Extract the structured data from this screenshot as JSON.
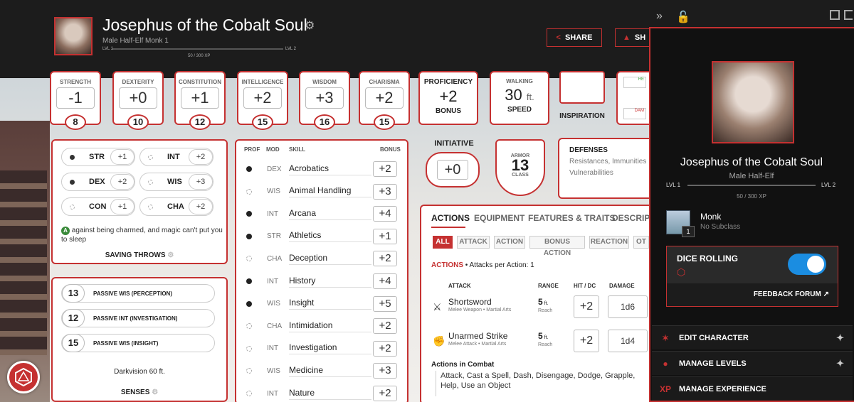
{
  "header": {
    "name": "Josephus of the Cobalt Soul",
    "subtitle": "Male  Half-Elf  Monk 1",
    "lvl_left": "LVL 1",
    "lvl_right": "LVL 2",
    "xp": "50 / 300 XP",
    "share_label": "SHARE",
    "share2_label": "SH"
  },
  "abilities": [
    {
      "label": "STRENGTH",
      "mod": "-1",
      "score": "8"
    },
    {
      "label": "DEXTERITY",
      "mod": "+0",
      "score": "10"
    },
    {
      "label": "CONSTITUTION",
      "mod": "+1",
      "score": "12"
    },
    {
      "label": "INTELLIGENCE",
      "mod": "+2",
      "score": "15"
    },
    {
      "label": "WISDOM",
      "mod": "+3",
      "score": "16"
    },
    {
      "label": "CHARISMA",
      "mod": "+2",
      "score": "15"
    }
  ],
  "proficiency": {
    "label": "PROFICIENCY",
    "value": "+2",
    "sub": "BONUS"
  },
  "walking": {
    "label": "WALKING",
    "value": "30",
    "unit": "ft.",
    "sub": "SPEED"
  },
  "inspiration": {
    "label": "INSPIRATION"
  },
  "hp_partial": {
    "heal": "HE",
    "dam": "DAM"
  },
  "saving_throws": {
    "rows": [
      {
        "ab": "STR",
        "val": "+1"
      },
      {
        "ab": "INT",
        "val": "+2"
      },
      {
        "ab": "DEX",
        "val": "+2"
      },
      {
        "ab": "WIS",
        "val": "+3"
      },
      {
        "ab": "CON",
        "val": "+1"
      },
      {
        "ab": "CHA",
        "val": "+2"
      }
    ],
    "note": "against being charmed, and magic can't put you to sleep",
    "title": "SAVING THROWS"
  },
  "senses": {
    "rows": [
      {
        "n": "13",
        "t": "PASSIVE WIS (PERCEPTION)"
      },
      {
        "n": "12",
        "t": "PASSIVE INT (INVESTIGATION)"
      },
      {
        "n": "15",
        "t": "PASSIVE WIS (INSIGHT)"
      }
    ],
    "darkvision": "Darkvision 60 ft.",
    "title": "SENSES"
  },
  "skills_header": {
    "prof": "PROF",
    "mod": "MOD",
    "skill": "SKILL",
    "bonus": "BONUS"
  },
  "skills": [
    {
      "mod": "DEX",
      "name": "Acrobatics",
      "bonus": "+2"
    },
    {
      "mod": "WIS",
      "name": "Animal Handling",
      "bonus": "+3"
    },
    {
      "mod": "INT",
      "name": "Arcana",
      "bonus": "+4"
    },
    {
      "mod": "STR",
      "name": "Athletics",
      "bonus": "+1"
    },
    {
      "mod": "CHA",
      "name": "Deception",
      "bonus": "+2"
    },
    {
      "mod": "INT",
      "name": "History",
      "bonus": "+4"
    },
    {
      "mod": "WIS",
      "name": "Insight",
      "bonus": "+5"
    },
    {
      "mod": "CHA",
      "name": "Intimidation",
      "bonus": "+2"
    },
    {
      "mod": "INT",
      "name": "Investigation",
      "bonus": "+2"
    },
    {
      "mod": "WIS",
      "name": "Medicine",
      "bonus": "+3"
    },
    {
      "mod": "INT",
      "name": "Nature",
      "bonus": "+2"
    }
  ],
  "initiative": {
    "label": "INITIATIVE",
    "value": "+0"
  },
  "armor": {
    "top": "ARMOR",
    "value": "13",
    "bottom": "CLASS"
  },
  "defenses": {
    "title": "DEFENSES",
    "line1": "Resistances, Immunities",
    "line2": "Vulnerabilities"
  },
  "tabs": [
    "ACTIONS",
    "EQUIPMENT",
    "FEATURES & TRAITS",
    "DESCRIPT"
  ],
  "chips": [
    "ALL",
    "ATTACK",
    "ACTION",
    "BONUS ACTION",
    "REACTION",
    "OT"
  ],
  "actions": {
    "heading": "ACTIONS",
    "per_action": "• Attacks per Action: 1",
    "cols": {
      "attack": "ATTACK",
      "range": "RANGE",
      "hit": "HIT / DC",
      "damage": "DAMAGE"
    },
    "rows": [
      {
        "name": "Shortsword",
        "sub": "Melee Weapon • Martial Arts",
        "range": "5",
        "unit": "ft.",
        "reach": "Reach",
        "hit": "+2",
        "dmg": "1d6"
      },
      {
        "name": "Unarmed Strike",
        "sub": "Melee Attack • Martial Arts",
        "range": "5",
        "unit": "ft.",
        "reach": "Reach",
        "hit": "+2",
        "dmg": "1d4"
      }
    ],
    "combat_title": "Actions in Combat",
    "combat_text": "Attack, Cast a Spell, Dash, Disengage, Dodge, Grapple, Help, Use an Object"
  },
  "sidebar": {
    "name": "Josephus of the Cobalt Soul",
    "subtitle": "Male  Half-Elf",
    "lvl_left": "LVL 1",
    "lvl_right": "LVL 2",
    "xp": "50 / 300 XP",
    "class_name": "Monk",
    "subclass": "No Subclass",
    "class_level": "1",
    "dice_label": "DICE ROLLING",
    "dice_on": true,
    "feedback": "FEEDBACK FORUM",
    "menu": [
      "EDIT CHARACTER",
      "MANAGE LEVELS",
      "MANAGE EXPERIENCE"
    ]
  },
  "colors": {
    "accent": "#c53131",
    "toggle": "#1b8de1"
  }
}
